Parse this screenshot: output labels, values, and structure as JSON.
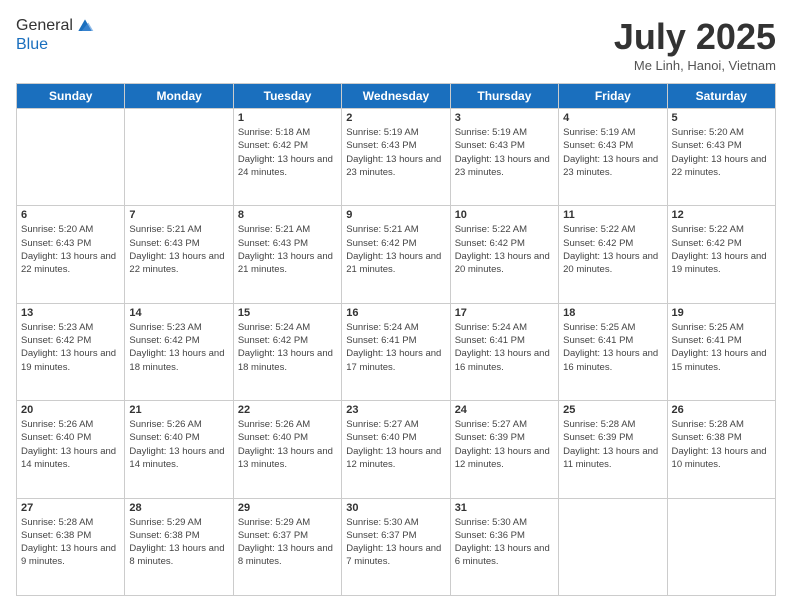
{
  "header": {
    "logo_line1": "General",
    "logo_line2": "Blue",
    "month_title": "July 2025",
    "location": "Me Linh, Hanoi, Vietnam"
  },
  "days_of_week": [
    "Sunday",
    "Monday",
    "Tuesday",
    "Wednesday",
    "Thursday",
    "Friday",
    "Saturday"
  ],
  "weeks": [
    [
      {
        "day": "",
        "info": ""
      },
      {
        "day": "",
        "info": ""
      },
      {
        "day": "1",
        "info": "Sunrise: 5:18 AM\nSunset: 6:42 PM\nDaylight: 13 hours and 24 minutes."
      },
      {
        "day": "2",
        "info": "Sunrise: 5:19 AM\nSunset: 6:43 PM\nDaylight: 13 hours and 23 minutes."
      },
      {
        "day": "3",
        "info": "Sunrise: 5:19 AM\nSunset: 6:43 PM\nDaylight: 13 hours and 23 minutes."
      },
      {
        "day": "4",
        "info": "Sunrise: 5:19 AM\nSunset: 6:43 PM\nDaylight: 13 hours and 23 minutes."
      },
      {
        "day": "5",
        "info": "Sunrise: 5:20 AM\nSunset: 6:43 PM\nDaylight: 13 hours and 22 minutes."
      }
    ],
    [
      {
        "day": "6",
        "info": "Sunrise: 5:20 AM\nSunset: 6:43 PM\nDaylight: 13 hours and 22 minutes."
      },
      {
        "day": "7",
        "info": "Sunrise: 5:21 AM\nSunset: 6:43 PM\nDaylight: 13 hours and 22 minutes."
      },
      {
        "day": "8",
        "info": "Sunrise: 5:21 AM\nSunset: 6:43 PM\nDaylight: 13 hours and 21 minutes."
      },
      {
        "day": "9",
        "info": "Sunrise: 5:21 AM\nSunset: 6:42 PM\nDaylight: 13 hours and 21 minutes."
      },
      {
        "day": "10",
        "info": "Sunrise: 5:22 AM\nSunset: 6:42 PM\nDaylight: 13 hours and 20 minutes."
      },
      {
        "day": "11",
        "info": "Sunrise: 5:22 AM\nSunset: 6:42 PM\nDaylight: 13 hours and 20 minutes."
      },
      {
        "day": "12",
        "info": "Sunrise: 5:22 AM\nSunset: 6:42 PM\nDaylight: 13 hours and 19 minutes."
      }
    ],
    [
      {
        "day": "13",
        "info": "Sunrise: 5:23 AM\nSunset: 6:42 PM\nDaylight: 13 hours and 19 minutes."
      },
      {
        "day": "14",
        "info": "Sunrise: 5:23 AM\nSunset: 6:42 PM\nDaylight: 13 hours and 18 minutes."
      },
      {
        "day": "15",
        "info": "Sunrise: 5:24 AM\nSunset: 6:42 PM\nDaylight: 13 hours and 18 minutes."
      },
      {
        "day": "16",
        "info": "Sunrise: 5:24 AM\nSunset: 6:41 PM\nDaylight: 13 hours and 17 minutes."
      },
      {
        "day": "17",
        "info": "Sunrise: 5:24 AM\nSunset: 6:41 PM\nDaylight: 13 hours and 16 minutes."
      },
      {
        "day": "18",
        "info": "Sunrise: 5:25 AM\nSunset: 6:41 PM\nDaylight: 13 hours and 16 minutes."
      },
      {
        "day": "19",
        "info": "Sunrise: 5:25 AM\nSunset: 6:41 PM\nDaylight: 13 hours and 15 minutes."
      }
    ],
    [
      {
        "day": "20",
        "info": "Sunrise: 5:26 AM\nSunset: 6:40 PM\nDaylight: 13 hours and 14 minutes."
      },
      {
        "day": "21",
        "info": "Sunrise: 5:26 AM\nSunset: 6:40 PM\nDaylight: 13 hours and 14 minutes."
      },
      {
        "day": "22",
        "info": "Sunrise: 5:26 AM\nSunset: 6:40 PM\nDaylight: 13 hours and 13 minutes."
      },
      {
        "day": "23",
        "info": "Sunrise: 5:27 AM\nSunset: 6:40 PM\nDaylight: 13 hours and 12 minutes."
      },
      {
        "day": "24",
        "info": "Sunrise: 5:27 AM\nSunset: 6:39 PM\nDaylight: 13 hours and 12 minutes."
      },
      {
        "day": "25",
        "info": "Sunrise: 5:28 AM\nSunset: 6:39 PM\nDaylight: 13 hours and 11 minutes."
      },
      {
        "day": "26",
        "info": "Sunrise: 5:28 AM\nSunset: 6:38 PM\nDaylight: 13 hours and 10 minutes."
      }
    ],
    [
      {
        "day": "27",
        "info": "Sunrise: 5:28 AM\nSunset: 6:38 PM\nDaylight: 13 hours and 9 minutes."
      },
      {
        "day": "28",
        "info": "Sunrise: 5:29 AM\nSunset: 6:38 PM\nDaylight: 13 hours and 8 minutes."
      },
      {
        "day": "29",
        "info": "Sunrise: 5:29 AM\nSunset: 6:37 PM\nDaylight: 13 hours and 8 minutes."
      },
      {
        "day": "30",
        "info": "Sunrise: 5:30 AM\nSunset: 6:37 PM\nDaylight: 13 hours and 7 minutes."
      },
      {
        "day": "31",
        "info": "Sunrise: 5:30 AM\nSunset: 6:36 PM\nDaylight: 13 hours and 6 minutes."
      },
      {
        "day": "",
        "info": ""
      },
      {
        "day": "",
        "info": ""
      }
    ]
  ]
}
